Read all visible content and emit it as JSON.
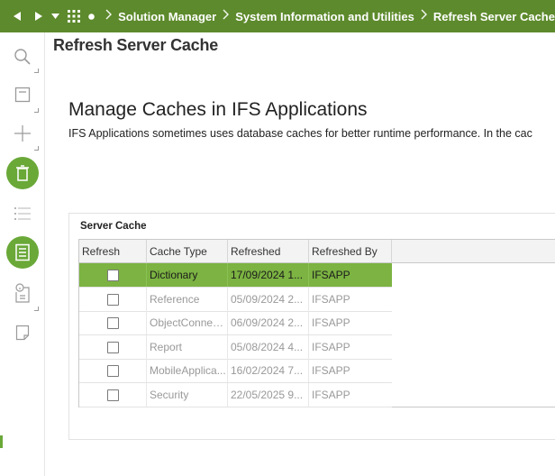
{
  "breadcrumb": {
    "items": [
      "Solution Manager",
      "System Information and Utilities",
      "Refresh Server Cache"
    ]
  },
  "icons": {
    "back": "arrow-left-icon",
    "forward": "arrow-right-icon",
    "menu": "chevron-down-icon",
    "apps": "grid-icon",
    "home": "dot-icon"
  },
  "page_title": "Refresh Server Cache",
  "section_title": "Manage Caches in IFS Applications",
  "description": "IFS Applications sometimes uses database caches for better runtime performance. In the cac",
  "group_title": "Server Cache",
  "table": {
    "columns": [
      "Refresh",
      "Cache Type",
      "Refreshed",
      "Refreshed By"
    ],
    "rows": [
      {
        "cache_type": "Dictionary",
        "refreshed": "17/09/2024 1...",
        "refreshed_by": "IFSAPP",
        "selected": true
      },
      {
        "cache_type": "Reference",
        "refreshed": "05/09/2024 2...",
        "refreshed_by": "IFSAPP",
        "selected": false
      },
      {
        "cache_type": "ObjectConnec...",
        "refreshed": "06/09/2024 2...",
        "refreshed_by": "IFSAPP",
        "selected": false
      },
      {
        "cache_type": "Report",
        "refreshed": "05/08/2024 4...",
        "refreshed_by": "IFSAPP",
        "selected": false
      },
      {
        "cache_type": "MobileApplica...",
        "refreshed": "16/02/2024 7...",
        "refreshed_by": "IFSAPP",
        "selected": false
      },
      {
        "cache_type": "Security",
        "refreshed": "22/05/2025 9...",
        "refreshed_by": "IFSAPP",
        "selected": false
      }
    ]
  },
  "colors": {
    "topbar": "#5d8a2c",
    "accent": "#6aa838",
    "selected_row": "#7cb342"
  }
}
